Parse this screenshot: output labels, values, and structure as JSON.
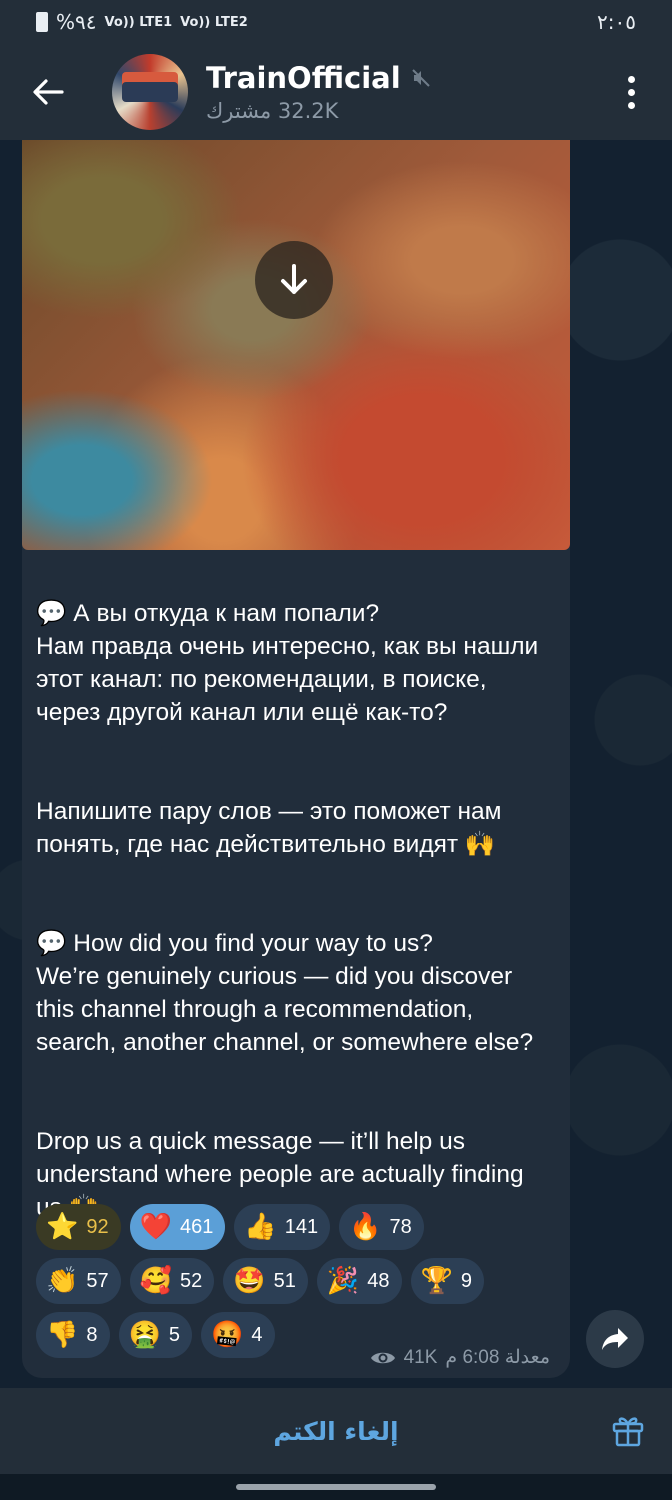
{
  "status_bar": {
    "time": "٢:٠٥",
    "battery": "%٩٤",
    "signal_1": "Vo)) LTE2",
    "signal_2": "Vo)) LTE1"
  },
  "header": {
    "channel_name": "TrainOfficial",
    "subscribers": "32.2K مشترك",
    "icons": [
      "back-arrow-icon",
      "muted-speaker-icon",
      "more-vert-icon"
    ]
  },
  "message": {
    "paragraphs": [
      "💬 А вы откуда к нам попали?\nНам правда очень интересно, как вы нашли этот канал: по рекомендации, в поиске, через другой канал или ещё как-то?",
      "Напишите пару слов — это поможет нам понять, где нас действительно видят 🙌",
      "💬 How did you find your way to us?\nWe’re genuinely curious — did you discover this channel through a recommendation, search, another channel, or somewhere else?",
      "Drop us a quick message — it’ll help us understand where people are actually finding us 🙌"
    ],
    "reactions": [
      [
        {
          "emoji": "⭐",
          "count": "92",
          "kind": "star"
        },
        {
          "emoji": "❤️",
          "count": "461",
          "kind": "selected"
        },
        {
          "emoji": "👍",
          "count": "141",
          "kind": "normal"
        },
        {
          "emoji": "🔥",
          "count": "78",
          "kind": "normal"
        }
      ],
      [
        {
          "emoji": "👏",
          "count": "57",
          "kind": "normal"
        },
        {
          "emoji": "🥰",
          "count": "52",
          "kind": "normal"
        },
        {
          "emoji": "🤩",
          "count": "51",
          "kind": "normal"
        },
        {
          "emoji": "🎉",
          "count": "48",
          "kind": "normal"
        },
        {
          "emoji": "🏆",
          "count": "9",
          "kind": "normal"
        }
      ],
      [
        {
          "emoji": "👎",
          "count": "8",
          "kind": "normal"
        },
        {
          "emoji": "🤮",
          "count": "5",
          "kind": "normal"
        },
        {
          "emoji": "🤬",
          "count": "4",
          "kind": "normal"
        }
      ]
    ],
    "views": "41K",
    "time": "معدلة 6:08 م"
  },
  "bottom_bar": {
    "unmute_label": "إلغاء الكتم"
  },
  "colors": {
    "header_bg": "#232e39",
    "bubble_bg": "#212d3b",
    "accent": "#5ea6e0",
    "reaction_bg": "#2c3f55",
    "selected_reaction": "#5b9fd7"
  }
}
